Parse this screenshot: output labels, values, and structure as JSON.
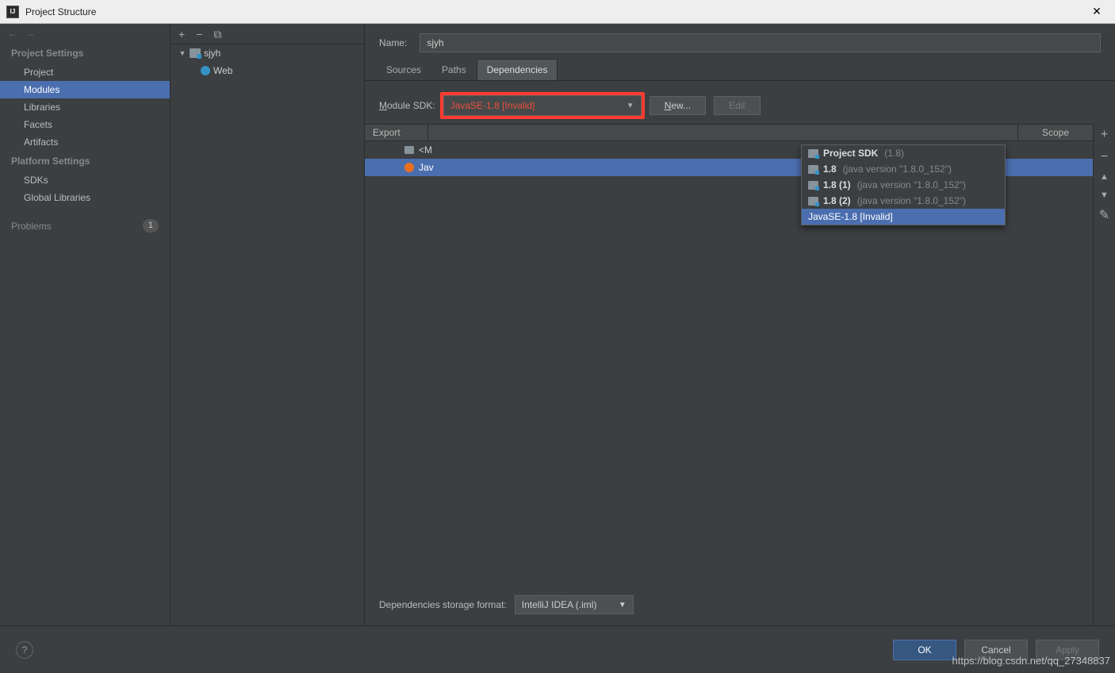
{
  "window": {
    "title": "Project Structure"
  },
  "sidebar": {
    "sections": {
      "project_settings": {
        "heading": "Project Settings",
        "items": [
          "Project",
          "Modules",
          "Libraries",
          "Facets",
          "Artifacts"
        ],
        "selected_index": 1
      },
      "platform_settings": {
        "heading": "Platform Settings",
        "items": [
          "SDKs",
          "Global Libraries"
        ]
      }
    },
    "problems": {
      "label": "Problems",
      "count": "1"
    }
  },
  "tree": {
    "root": {
      "name": "sjyh",
      "expanded": true
    },
    "children": [
      {
        "name": "Web"
      }
    ]
  },
  "detail": {
    "name_label": "Name:",
    "name_value": "sjyh",
    "tabs": [
      "Sources",
      "Paths",
      "Dependencies"
    ],
    "active_tab_index": 2,
    "module_sdk_label_pre": "M",
    "module_sdk_label_post": "odule SDK:",
    "module_sdk_value": "JavaSE-1.8 [Invalid]",
    "new_btn_pre": "N",
    "new_btn_post": "ew...",
    "edit_btn": "Edit",
    "table": {
      "col_export": "Export",
      "col_scope": "Scope",
      "rows": [
        {
          "label": "<M",
          "selected": false,
          "icon": "module"
        },
        {
          "label": "Jav",
          "selected": true,
          "icon": "java"
        }
      ]
    },
    "storage_label": "Dependencies storage format:",
    "storage_value": "IntelliJ IDEA (.iml)"
  },
  "dropdown": {
    "items": [
      {
        "name": "Project SDK",
        "extra": "(1.8)"
      },
      {
        "name": "1.8",
        "extra": "(java version \"1.8.0_152\")"
      },
      {
        "name": "1.8 (1)",
        "extra": "(java version \"1.8.0_152\")"
      },
      {
        "name": "1.8 (2)",
        "extra": "(java version \"1.8.0_152\")"
      }
    ],
    "invalid": {
      "name": "JavaSE-1.8 [Invalid]"
    }
  },
  "footer": {
    "ok": "OK",
    "cancel": "Cancel",
    "apply": "Apply"
  },
  "watermark": "https://blog.csdn.net/qq_27348837"
}
